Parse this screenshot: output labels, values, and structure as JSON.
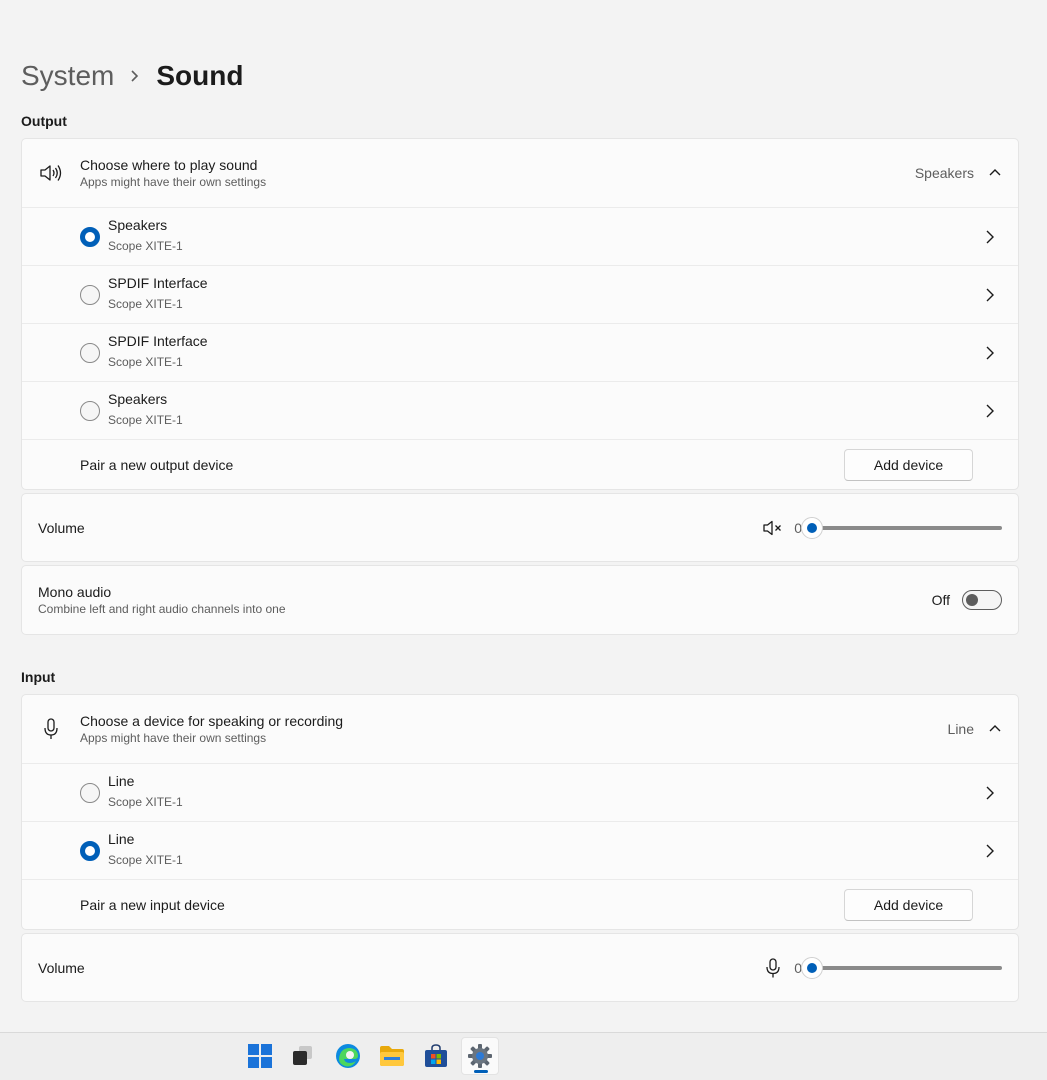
{
  "breadcrumb": {
    "parent": "System",
    "current": "Sound"
  },
  "output": {
    "section_label": "Output",
    "header": {
      "title": "Choose where to play sound",
      "subtitle": "Apps might have their own settings",
      "value": "Speakers",
      "icon": "speaker-icon"
    },
    "devices": [
      {
        "name": "Speakers",
        "detail": "Scope XITE-1",
        "selected": true
      },
      {
        "name": "SPDIF Interface",
        "detail": "Scope XITE-1",
        "selected": false
      },
      {
        "name": "SPDIF Interface",
        "detail": "Scope XITE-1",
        "selected": false
      },
      {
        "name": "Speakers",
        "detail": "Scope XITE-1",
        "selected": false
      }
    ],
    "pair": {
      "label": "Pair a new output device",
      "button": "Add device"
    },
    "volume": {
      "label": "Volume",
      "value": "0",
      "level": 0,
      "icon": "speaker-muted-icon"
    },
    "mono": {
      "title": "Mono audio",
      "subtitle": "Combine left and right audio channels into one",
      "state": "Off"
    }
  },
  "input": {
    "section_label": "Input",
    "header": {
      "title": "Choose a device for speaking or recording",
      "subtitle": "Apps might have their own settings",
      "value": "Line",
      "icon": "microphone-icon"
    },
    "devices": [
      {
        "name": "Line",
        "detail": "Scope XITE-1",
        "selected": false
      },
      {
        "name": "Line",
        "detail": "Scope XITE-1",
        "selected": true
      }
    ],
    "pair": {
      "label": "Pair a new input device",
      "button": "Add device"
    },
    "volume": {
      "label": "Volume",
      "value": "0",
      "level": 0,
      "icon": "microphone-icon"
    }
  },
  "taskbar": {
    "icons": [
      "windows-start-icon",
      "task-view-icon",
      "edge-browser-icon",
      "file-explorer-icon",
      "microsoft-store-icon",
      "settings-gear-icon"
    ],
    "active": "settings-gear-icon"
  },
  "colors": {
    "accent": "#005fb8",
    "background": "#f3f3f3",
    "card": "#fbfbfb"
  }
}
